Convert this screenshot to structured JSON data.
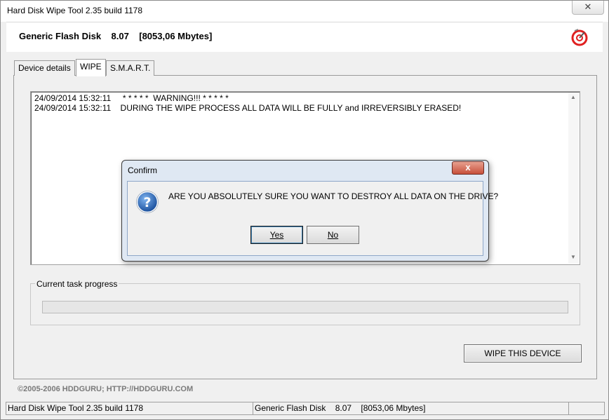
{
  "window": {
    "title": "Hard Disk Wipe Tool 2.35 build 1178",
    "close_symbol": "✕"
  },
  "header": {
    "device_title": "Generic Flash Disk    8.07    [8053,06 Mbytes]",
    "logo_icon": "hddguru-logo-icon"
  },
  "tabs": [
    {
      "label": "Device details",
      "active": false
    },
    {
      "label": "WIPE",
      "active": true
    },
    {
      "label": "S.M.A.R.T.",
      "active": false
    }
  ],
  "log": [
    "24/09/2014 15:32:11     * * * * *  WARNING!!! * * * * *",
    "24/09/2014 15:32:11    DURING THE WIPE PROCESS ALL DATA WILL BE FULLY and IRREVERSIBLY ERASED!"
  ],
  "progress": {
    "label": "Current task progress",
    "fraction": 0
  },
  "wipe_button": "WIPE THIS DEVICE",
  "copyright": "©2005-2006 HDDGURU;  HTTP://HDDGURU.COM",
  "statusbar": [
    "Hard Disk Wipe Tool 2.35 build 1178",
    "Generic Flash Disk    8.07    [8053,06 Mbytes]",
    ""
  ],
  "dialog": {
    "title": "Confirm",
    "close_symbol": "x",
    "message": "ARE YOU ABSOLUTELY SURE YOU WANT TO DESTROY ALL DATA ON THE DRIVE?",
    "icon": "question-icon",
    "yes_label": "Yes",
    "no_label": "No"
  },
  "colors": {
    "dialog_frame": "#dfe8f3",
    "dialog_close": "#c7503b",
    "logo_red": "#e02020"
  }
}
